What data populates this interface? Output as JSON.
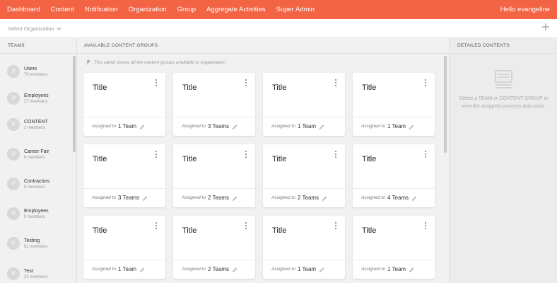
{
  "nav": {
    "items": [
      "Dashboard",
      "Content",
      "Notification",
      "Organization",
      "Group",
      "Aggregate Activities",
      "Super Admin"
    ],
    "user": "Hello evangeline"
  },
  "org_bar": {
    "select_label": "Select Organization",
    "add_icon": "plus-icon"
  },
  "teams": {
    "header": "TEAMS",
    "items": [
      {
        "initial": "V",
        "name": "Users",
        "members": "70 members"
      },
      {
        "initial": "V",
        "name": "Employees",
        "members": "27 members"
      },
      {
        "initial": "V",
        "name": "CONTENT",
        "members": "2 members"
      },
      {
        "initial": "V",
        "name": "Career Fair",
        "members": "6 members"
      },
      {
        "initial": "V",
        "name": "Contractors",
        "members": "5 members"
      },
      {
        "initial": "V",
        "name": "Employees",
        "members": "9 members"
      },
      {
        "initial": "V",
        "name": "Testing",
        "members": "61 members"
      },
      {
        "initial": "V",
        "name": "Test",
        "members": "22 members"
      }
    ]
  },
  "groups": {
    "header": "AVAILABLE CONTENT GROUPS",
    "info": "This panel shows all the content groups available to organization",
    "assigned_prefix": "Assigned to",
    "cards": [
      {
        "title": "Title",
        "assigned": "1 Team"
      },
      {
        "title": "Title",
        "assigned": "3 Teams"
      },
      {
        "title": "Title",
        "assigned": "1 Team"
      },
      {
        "title": "Title",
        "assigned": "1 Team"
      },
      {
        "title": "Title",
        "assigned": "3 Teams"
      },
      {
        "title": "Title",
        "assigned": "2 Teams"
      },
      {
        "title": "Title",
        "assigned": "2 Teams"
      },
      {
        "title": "Title",
        "assigned": "4 Teams"
      },
      {
        "title": "Title",
        "assigned": "1 Team"
      },
      {
        "title": "Title",
        "assigned": "2 Teams"
      },
      {
        "title": "Title",
        "assigned": "1 Team"
      },
      {
        "title": "Title",
        "assigned": "1 Team"
      }
    ]
  },
  "details": {
    "header": "DETAILED CONTENTS",
    "message": "Select a TEAM or CONTENT GROUP to view the assigned journeys and cards."
  },
  "colors": {
    "brand": "#f36445",
    "background": "#f1f1f1"
  }
}
